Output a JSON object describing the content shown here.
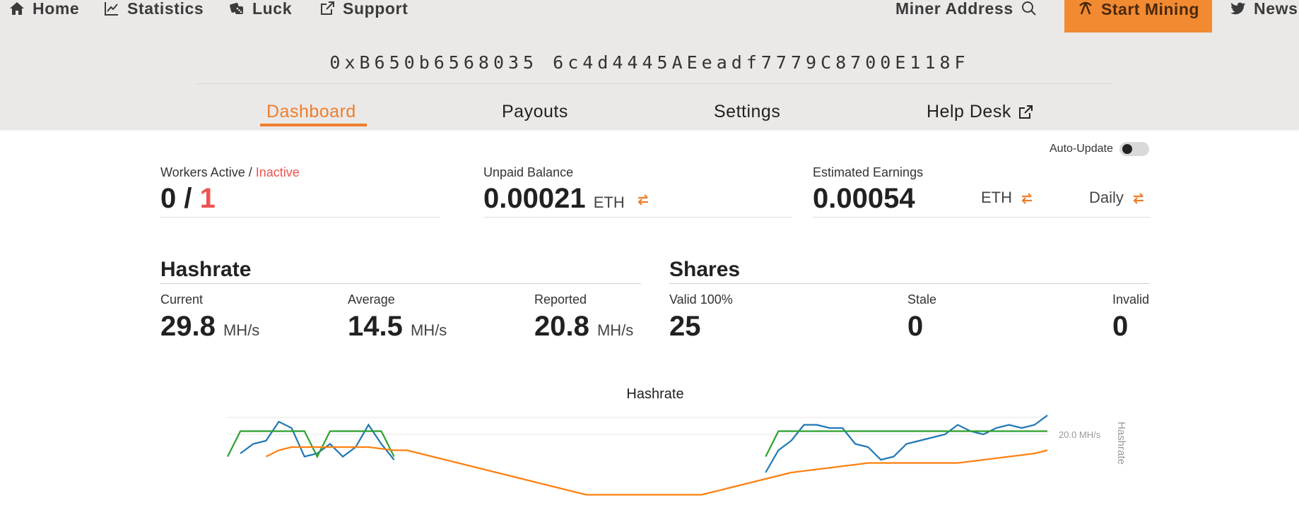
{
  "nav": {
    "home": "Home",
    "statistics": "Statistics",
    "luck": "Luck",
    "support": "Support",
    "miner_address": "Miner Address",
    "start_mining": "Start Mining",
    "news": "News"
  },
  "address": "0xB650b6568035 6c4d4445AEeadf7779C8700E118F",
  "tabs": {
    "dashboard": "Dashboard",
    "payouts": "Payouts",
    "settings": "Settings",
    "help_desk": "Help Desk"
  },
  "auto_update": {
    "label": "Auto-Update",
    "on": false
  },
  "workers": {
    "label_active": "Workers Active /",
    "label_inactive": "Inactive",
    "active": "0 /",
    "inactive": "1"
  },
  "unpaid": {
    "label": "Unpaid Balance",
    "value": "0.00021",
    "unit": "ETH"
  },
  "earnings": {
    "label": "Estimated Earnings",
    "value": "0.00054",
    "unit": "ETH",
    "period": "Daily"
  },
  "hashrate": {
    "title": "Hashrate",
    "current_label": "Current",
    "current": "29.8",
    "current_unit": "MH/s",
    "average_label": "Average",
    "average": "14.5",
    "average_unit": "MH/s",
    "reported_label": "Reported",
    "reported": "20.8",
    "reported_unit": "MH/s"
  },
  "shares": {
    "title": "Shares",
    "valid_label": "Valid 100%",
    "valid": "25",
    "stale_label": "Stale",
    "stale": "0",
    "invalid_label": "Invalid",
    "invalid": "0"
  },
  "colors": {
    "accent": "#ef7d2b",
    "inactive": "#ef5350",
    "series_current": "#1f77b4",
    "series_reported": "#2ca02c",
    "series_average": "#ff7f0e"
  },
  "chart_data": {
    "type": "line",
    "title": "Hashrate",
    "ylabel": "Hashrate",
    "y_tick_labels": [
      "20.0 MH/s"
    ],
    "series": [
      {
        "values": [
          null,
          14,
          17,
          18,
          24,
          22,
          13,
          14,
          17,
          13,
          16,
          23,
          17,
          12,
          null,
          null,
          null,
          null,
          null,
          null,
          null,
          null,
          null,
          null,
          null,
          null,
          null,
          null,
          null,
          null,
          null,
          null,
          null,
          null,
          null,
          null,
          null,
          null,
          null,
          null,
          null,
          null,
          8,
          15,
          18,
          23,
          23,
          22,
          22,
          17,
          16,
          12,
          13,
          17,
          18,
          19,
          20,
          23,
          21,
          20,
          22,
          23,
          22,
          23,
          26
        ]
      },
      {
        "values": [
          13,
          21,
          21,
          21,
          21,
          21,
          21,
          13,
          21,
          21,
          21,
          21,
          21,
          13,
          null,
          null,
          null,
          null,
          null,
          null,
          null,
          null,
          null,
          null,
          null,
          null,
          null,
          null,
          null,
          null,
          null,
          null,
          null,
          null,
          null,
          null,
          null,
          null,
          null,
          null,
          null,
          null,
          13,
          21,
          21,
          21,
          21,
          21,
          21,
          21,
          21,
          21,
          21,
          21,
          21,
          21,
          21,
          21,
          21,
          21,
          21,
          21,
          21,
          21,
          21
        ]
      },
      {
        "values": [
          null,
          null,
          null,
          13,
          15,
          16,
          16,
          16,
          16,
          16,
          16,
          16,
          15.5,
          15,
          15,
          14,
          13,
          12,
          11,
          10,
          9,
          8,
          7,
          6,
          5,
          4,
          3,
          2,
          1,
          1,
          1,
          1,
          1,
          1,
          1,
          1,
          1,
          1,
          2,
          3,
          4,
          5,
          6,
          7,
          8,
          8.5,
          9,
          9.5,
          10,
          10.5,
          11,
          11,
          11,
          11,
          11,
          11,
          11,
          11,
          11.5,
          12,
          12.5,
          13,
          13.5,
          14,
          15
        ]
      }
    ]
  }
}
